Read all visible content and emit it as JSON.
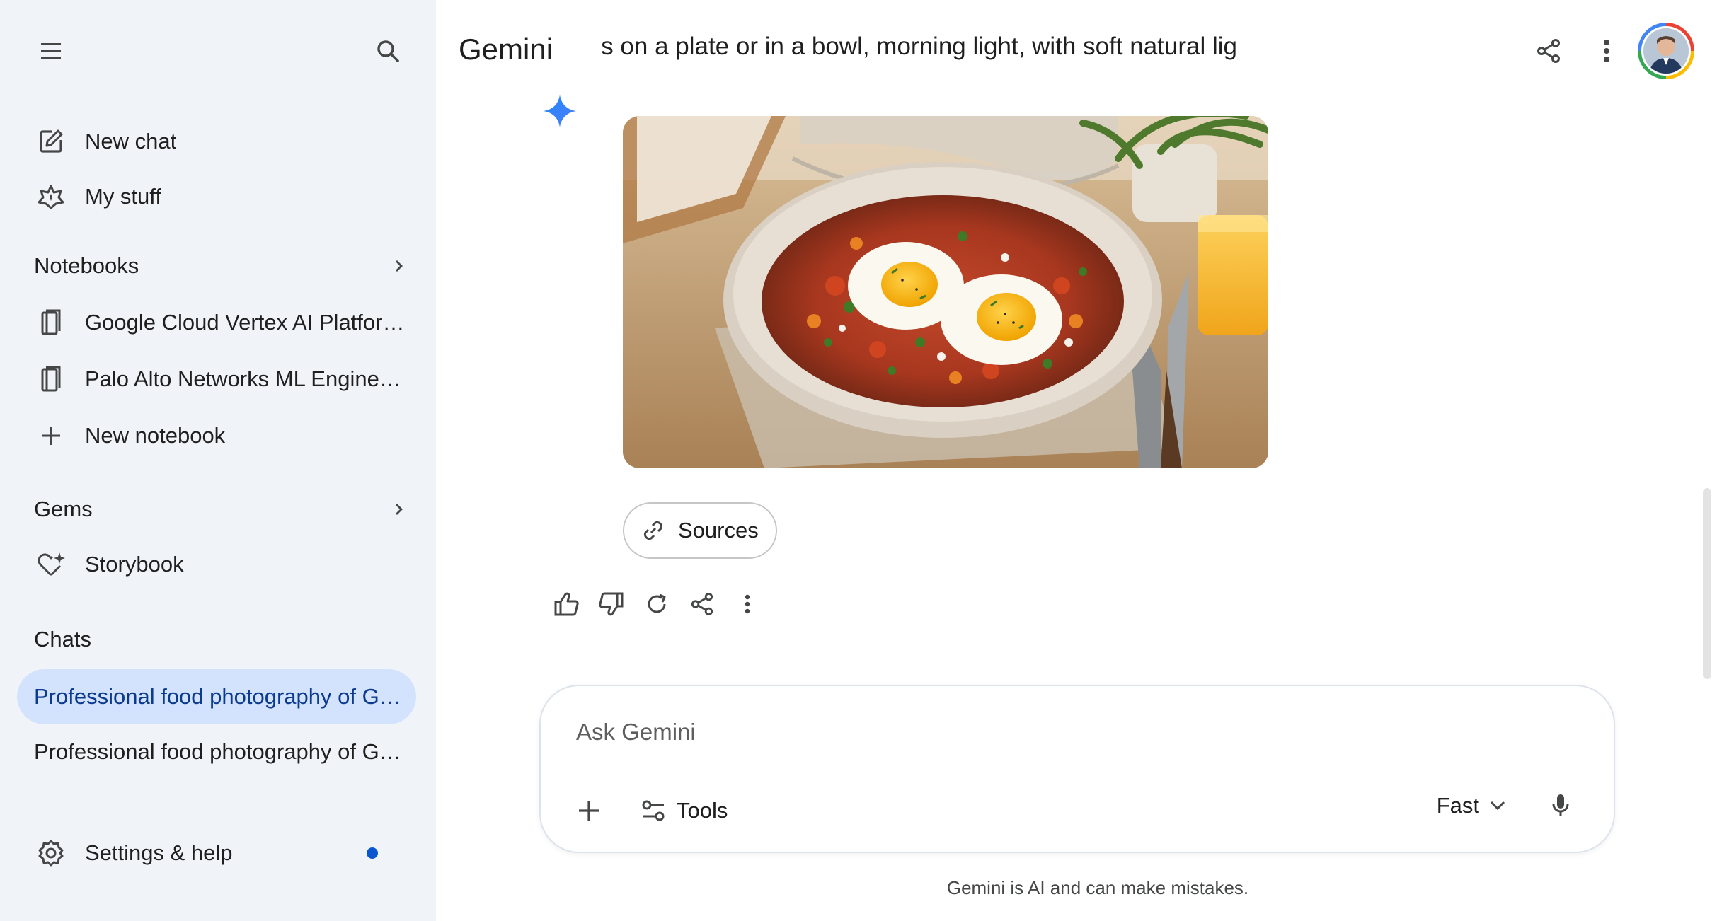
{
  "app": {
    "brand": "Gemini"
  },
  "conversation": {
    "title": "Professional food photography of Gluten-free shakshuka with satisfying textures. The dish is on a plate or in a bowl, morning light, with soft natural light",
    "title_visible": "atisfying textures. The dish is on a plate or in a bowl, morning light, with soft natural lig"
  },
  "sidebar": {
    "new_chat": "New chat",
    "my_stuff": "My stuff",
    "notebooks_header": "Notebooks",
    "notebooks": [
      {
        "label": "Google Cloud Vertex AI Platform…"
      },
      {
        "label": "Palo Alto Networks ML Engineer…"
      }
    ],
    "new_notebook": "New notebook",
    "gems_header": "Gems",
    "gems": [
      {
        "label": "Storybook"
      }
    ],
    "chats_header": "Chats",
    "chats": [
      {
        "label": "Professional food photography of Glu…",
        "active": true
      },
      {
        "label": "Professional food photography of Glu…",
        "active": false
      }
    ],
    "settings": "Settings & help"
  },
  "response": {
    "sources_label": "Sources",
    "image_subject": "shakshuka with two fried eggs in a speckled bowl on linen, fork and knife, orange juice, fern, window light"
  },
  "composer": {
    "placeholder": "Ask Gemini",
    "tools_label": "Tools",
    "model_label": "Fast"
  },
  "footer": {
    "disclaimer": "Gemini is AI and can make mistakes."
  },
  "colors": {
    "sidebar_bg": "#f0f4f9",
    "active_chat_bg": "#d3e3fd",
    "active_chat_text": "#0b3a8f",
    "accent_blue": "#0b57d0",
    "icon_gray": "#444746"
  },
  "icons": {
    "menu": "menu-icon",
    "search": "search-icon",
    "new_chat": "edit-square-icon",
    "my_stuff": "star-badge-icon",
    "notebook": "notebook-icon",
    "add": "plus-icon",
    "gem": "heart-sparkle-icon",
    "settings": "gear-icon",
    "share": "share-icon",
    "more": "more-vert-icon",
    "sparkle": "gemini-sparkle-icon",
    "link": "link-icon",
    "thumb_up": "thumb-up-icon",
    "thumb_down": "thumb-down-icon",
    "redo": "refresh-icon",
    "tools": "tune-icon",
    "chevron": "chevron-down-icon",
    "mic": "mic-icon"
  }
}
